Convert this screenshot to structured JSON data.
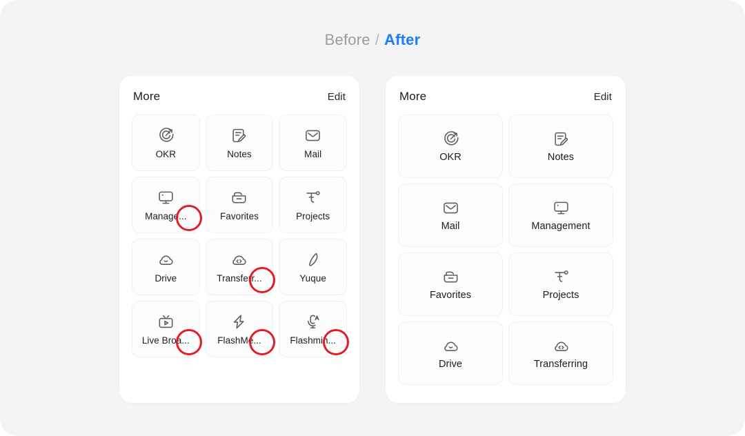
{
  "header": {
    "before_label": "Before",
    "separator": "/",
    "after_label": "After",
    "before_color": "#9b9b9f",
    "after_color": "#1a7cff"
  },
  "annotation": {
    "color": "#e31b23",
    "meaning": "truncated-label-marker"
  },
  "before_panel": {
    "title": "More",
    "edit_label": "Edit",
    "columns": 3,
    "tiles": [
      {
        "label": "OKR",
        "icon": "target-arrow-icon",
        "truncated": false
      },
      {
        "label": "Notes",
        "icon": "note-pencil-icon",
        "truncated": false
      },
      {
        "label": "Mail",
        "icon": "envelope-icon",
        "truncated": false
      },
      {
        "label": "Manage...",
        "icon": "monitor-icon",
        "truncated": true
      },
      {
        "label": "Favorites",
        "icon": "folder-icon",
        "truncated": false
      },
      {
        "label": "Projects",
        "icon": "projects-icon",
        "truncated": false
      },
      {
        "label": "Drive",
        "icon": "cloud-icon",
        "truncated": false
      },
      {
        "label": "Transferr...",
        "icon": "cloud-transfer-icon",
        "truncated": true
      },
      {
        "label": "Yuque",
        "icon": "leaf-icon",
        "truncated": false
      },
      {
        "label": "Live Broa...",
        "icon": "live-tv-icon",
        "truncated": true
      },
      {
        "label": "FlashMe...",
        "icon": "lightning-icon",
        "truncated": true
      },
      {
        "label": "Flashmin...",
        "icon": "mic-transcribe-icon",
        "truncated": true
      }
    ]
  },
  "after_panel": {
    "title": "More",
    "edit_label": "Edit",
    "columns": 2,
    "tiles": [
      {
        "label": "OKR",
        "icon": "target-arrow-icon",
        "truncated": false
      },
      {
        "label": "Notes",
        "icon": "note-pencil-icon",
        "truncated": false
      },
      {
        "label": "Mail",
        "icon": "envelope-icon",
        "truncated": false
      },
      {
        "label": "Management",
        "icon": "monitor-icon",
        "truncated": false
      },
      {
        "label": "Favorites",
        "icon": "folder-icon",
        "truncated": false
      },
      {
        "label": "Projects",
        "icon": "projects-icon",
        "truncated": false
      },
      {
        "label": "Drive",
        "icon": "cloud-icon",
        "truncated": false
      },
      {
        "label": "Transferring",
        "icon": "cloud-transfer-icon",
        "truncated": false
      }
    ]
  }
}
